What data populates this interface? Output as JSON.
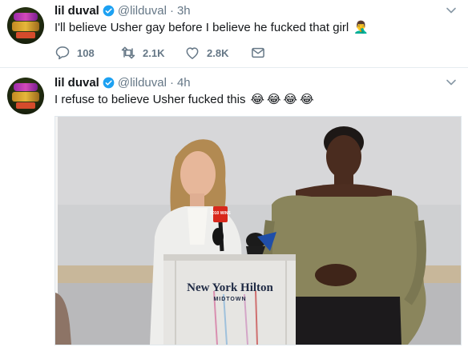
{
  "tweets": [
    {
      "name": "lil duval",
      "handle": "@lilduval",
      "separator": "·",
      "time": "3h",
      "text": "I'll believe Usher gay before I believe he fucked that girl",
      "emoji": [
        "🤦‍♂️"
      ],
      "actions": {
        "replies": "108",
        "retweets": "2.1K",
        "likes": "2.8K"
      }
    },
    {
      "name": "lil duval",
      "handle": "@lilduval",
      "separator": "·",
      "time": "4h",
      "text": "I refuse to believe Usher fucked this",
      "emoji": [
        "😂",
        "😂",
        "😂",
        "😂"
      ],
      "media": {
        "podium_sign": "New York Hilton",
        "podium_sub": "MIDTOWN",
        "mic_flag": "1010 WINS"
      }
    }
  ],
  "colors": {
    "verified": "#1da1f2",
    "muted": "#657786",
    "text": "#14171a"
  },
  "icons": [
    "verified-badge-icon",
    "chevron-down-icon",
    "reply-icon",
    "retweet-icon",
    "like-icon",
    "direct-message-icon"
  ]
}
